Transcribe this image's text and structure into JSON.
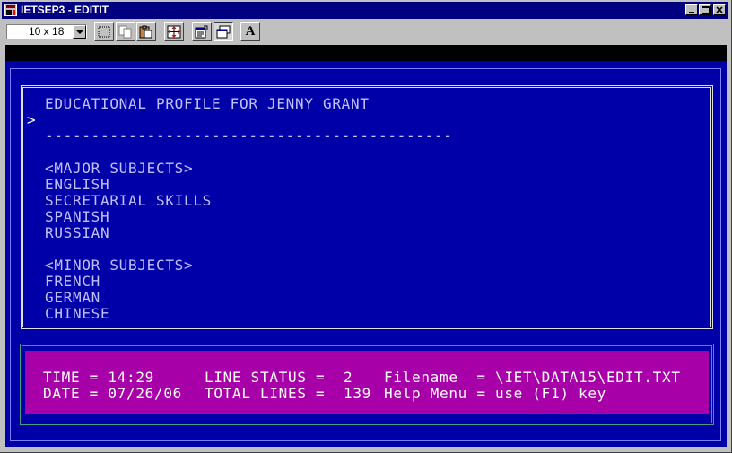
{
  "window": {
    "title": "IETSEP3 - EDITIT"
  },
  "toolbar": {
    "font_size_value": "10 x 18",
    "buttons": [
      {
        "icon": "mark-icon"
      },
      {
        "icon": "copy-icon"
      },
      {
        "icon": "paste-icon"
      },
      {
        "icon": "full-screen-icon"
      },
      {
        "icon": "properties-icon"
      },
      {
        "icon": "background-icon"
      },
      {
        "icon": "font-icon",
        "label": "A"
      }
    ]
  },
  "editor": {
    "cursor_char": ">",
    "lines": [
      "EDUCATIONAL PROFILE FOR JENNY GRANT",
      "--------------------------------------------",
      "<MAJOR SUBJECTS>",
      "ENGLISH",
      "SECRETARIAL SKILLS",
      "SPANISH",
      "RUSSIAN",
      "<MINOR SUBJECTS>",
      "FRENCH",
      "GERMAN",
      "CHINESE"
    ]
  },
  "status": {
    "time_label": "TIME = 14:29",
    "date_label": "DATE = 07/26/06",
    "line_status_label": "LINE STATUS =  2",
    "total_lines_label": "TOTAL LINES =  139",
    "filename_label": "Filename  = \\IET\\DATA15\\EDIT.TXT",
    "help_label": "Help Menu = use (F1) key"
  },
  "colors": {
    "console_bg": "#0000a8",
    "status_bg": "#a800a8",
    "text": "#c0c0ff",
    "title_bar": "#000080"
  }
}
